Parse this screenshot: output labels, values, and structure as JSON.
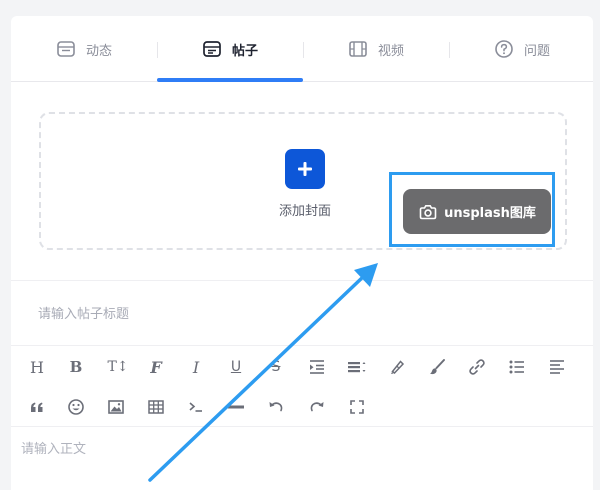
{
  "tabs": [
    {
      "label": "动态",
      "icon": "feed-icon"
    },
    {
      "label": "帖子",
      "icon": "post-icon",
      "active": true
    },
    {
      "label": "视频",
      "icon": "video-icon"
    },
    {
      "label": "问题",
      "icon": "question-icon"
    }
  ],
  "cover": {
    "add_label": "添加封面",
    "unsplash_label": "unsplash图库"
  },
  "title": {
    "placeholder": "请输入帖子标题"
  },
  "toolbar": {
    "row1": [
      "heading",
      "bold",
      "font-size",
      "font-family",
      "italic",
      "underline",
      "strikethrough",
      "indent",
      "line-height",
      "highlight",
      "brush",
      "link",
      "bullet-list",
      "align-left"
    ],
    "row2": [
      "quote",
      "emoji",
      "image",
      "table",
      "code",
      "divider",
      "undo",
      "redo",
      "fullscreen"
    ],
    "glyphs": {
      "heading": "H",
      "bold": "B",
      "font-size": "T↕",
      "font-family": "F",
      "italic": "I",
      "underline": "U",
      "strikethrough": "S"
    }
  },
  "editor": {
    "placeholder": "请输入正文"
  },
  "colors": {
    "accent": "#2f7df6",
    "add_button": "#0d57d8",
    "unsplash_button": "#6b6b6d",
    "highlight": "#2d9cf0"
  }
}
